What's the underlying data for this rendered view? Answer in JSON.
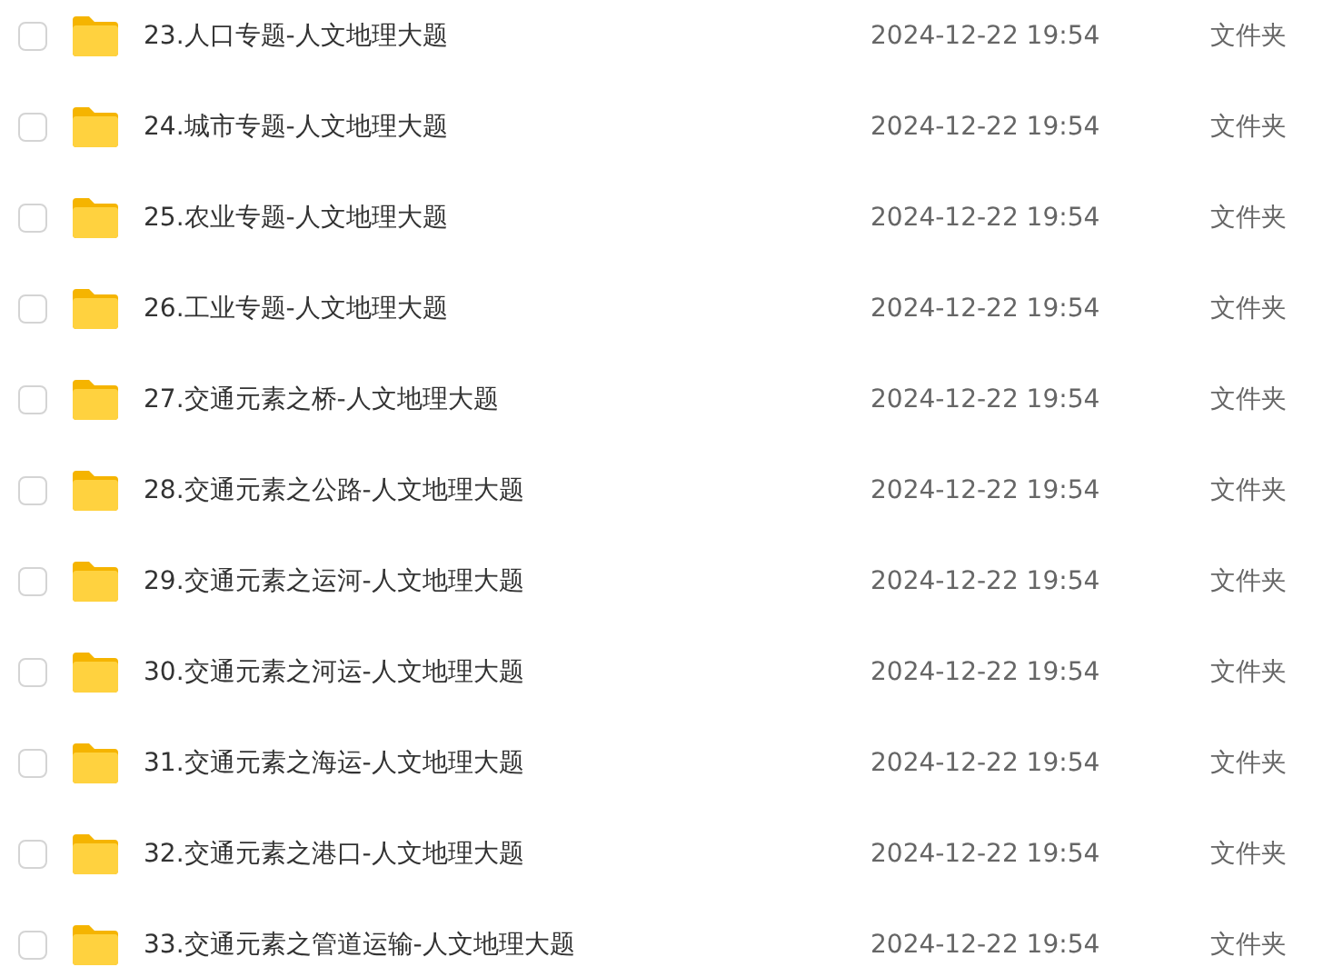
{
  "files": [
    {
      "name": "23.人口专题-人文地理大题",
      "modified": "2024-12-22 19:54",
      "type": "文件夹",
      "checked": false
    },
    {
      "name": "24.城市专题-人文地理大题",
      "modified": "2024-12-22 19:54",
      "type": "文件夹",
      "checked": false
    },
    {
      "name": "25.农业专题-人文地理大题",
      "modified": "2024-12-22 19:54",
      "type": "文件夹",
      "checked": false
    },
    {
      "name": "26.工业专题-人文地理大题",
      "modified": "2024-12-22 19:54",
      "type": "文件夹",
      "checked": false
    },
    {
      "name": "27.交通元素之桥-人文地理大题",
      "modified": "2024-12-22 19:54",
      "type": "文件夹",
      "checked": false
    },
    {
      "name": "28.交通元素之公路-人文地理大题",
      "modified": "2024-12-22 19:54",
      "type": "文件夹",
      "checked": false
    },
    {
      "name": "29.交通元素之运河-人文地理大题",
      "modified": "2024-12-22 19:54",
      "type": "文件夹",
      "checked": false
    },
    {
      "name": "30.交通元素之河运-人文地理大题",
      "modified": "2024-12-22 19:54",
      "type": "文件夹",
      "checked": false
    },
    {
      "name": "31.交通元素之海运-人文地理大题",
      "modified": "2024-12-22 19:54",
      "type": "文件夹",
      "checked": false
    },
    {
      "name": "32.交通元素之港口-人文地理大题",
      "modified": "2024-12-22 19:54",
      "type": "文件夹",
      "checked": false
    },
    {
      "name": "33.交通元素之管道运输-人文地理大题",
      "modified": "2024-12-22 19:54",
      "type": "文件夹",
      "checked": false
    }
  ]
}
